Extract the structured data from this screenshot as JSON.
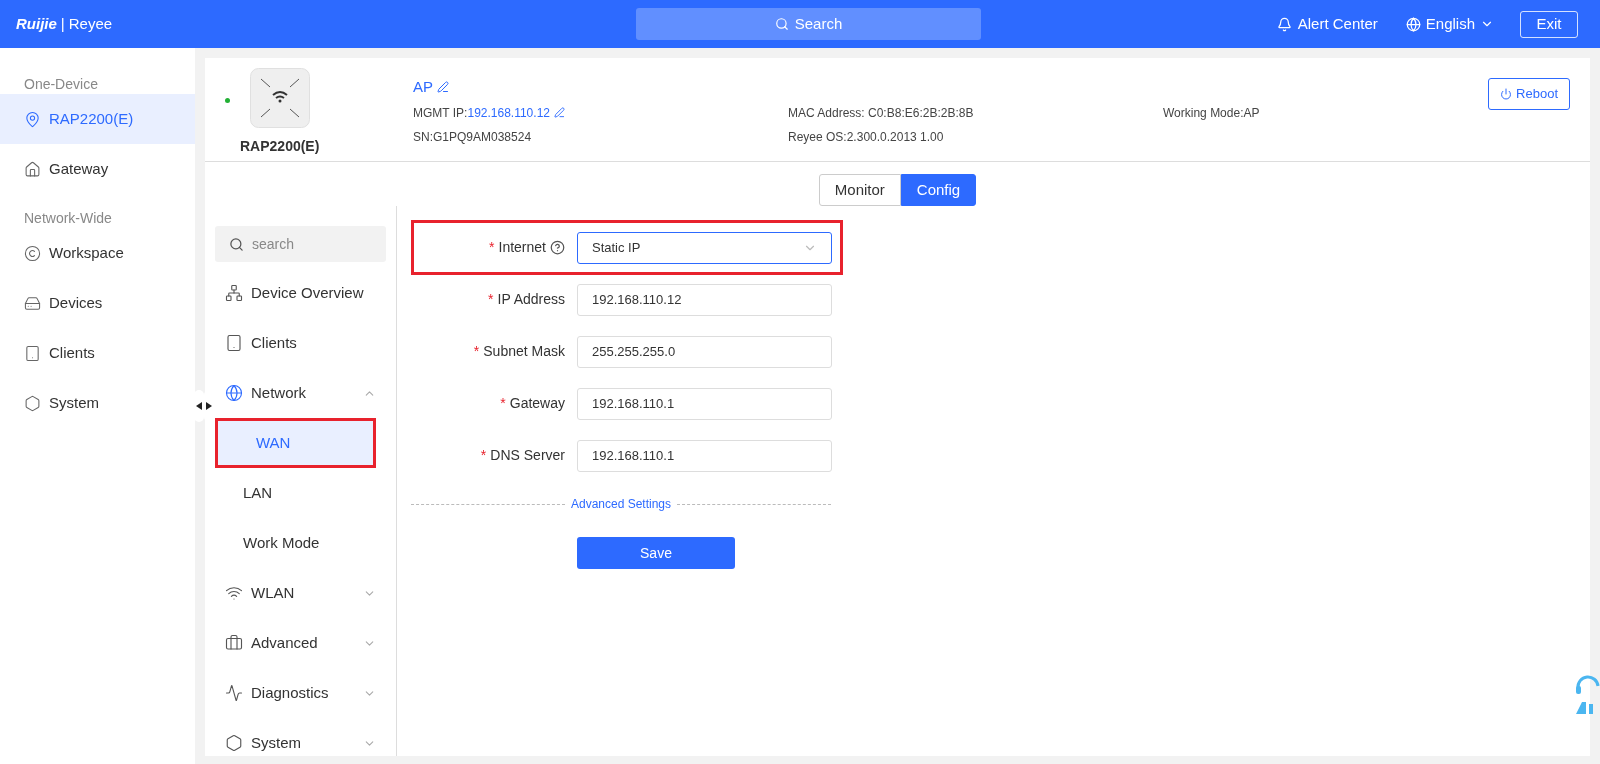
{
  "header": {
    "logo": {
      "brand": "Ruijie",
      "separator": "|",
      "product": "Reyee"
    },
    "search": "Search",
    "alert": "Alert Center",
    "language": "English",
    "exit": "Exit"
  },
  "sidebar": {
    "sections": [
      {
        "title": "One-Device",
        "items": [
          {
            "label": "RAP2200(E)",
            "selected": true
          },
          {
            "label": "Gateway",
            "selected": false
          }
        ]
      },
      {
        "title": "Network-Wide",
        "items": [
          {
            "label": "Workspace",
            "selected": false
          },
          {
            "label": "Devices",
            "selected": false
          },
          {
            "label": "Clients",
            "selected": false
          },
          {
            "label": "System",
            "selected": false
          }
        ]
      }
    ]
  },
  "device": {
    "online": true,
    "model": "RAP2200(E)",
    "name": "AP",
    "mgmt_ip_label": "MGMT IP:",
    "mgmt_ip": "192.168.110.12",
    "sn": "SN:G1PQ9AM038524",
    "mac": "MAC Address: C0:B8:E6:2B:2B:8B",
    "os": "Reyee OS:2.300.0.2013 1.00",
    "mode": "Working Mode:AP",
    "reboot": "Reboot"
  },
  "tabs": [
    {
      "label": "Monitor",
      "selected": false
    },
    {
      "label": "Config",
      "selected": true
    }
  ],
  "menu": {
    "search_placeholder": "search",
    "items": [
      {
        "label": "Device Overview"
      },
      {
        "label": "Clients"
      },
      {
        "label": "Network",
        "expanded": true,
        "children": [
          {
            "label": "WAN",
            "selected": true,
            "highlighted": true
          },
          {
            "label": "LAN",
            "selected": false,
            "highlighted": false
          },
          {
            "label": "Work Mode",
            "selected": false,
            "highlighted": false
          }
        ]
      },
      {
        "label": "WLAN",
        "expanded": false
      },
      {
        "label": "Advanced",
        "expanded": false
      },
      {
        "label": "Diagnostics",
        "expanded": false
      },
      {
        "label": "System",
        "expanded": false
      }
    ]
  },
  "form": {
    "fields": [
      {
        "kind": "select",
        "required_mark": "*",
        "label": "Internet",
        "help": true,
        "value": "Static IP",
        "highlighted": true
      },
      {
        "kind": "input",
        "required_mark": "*",
        "label": "IP Address",
        "help": false,
        "value": "192.168.110.12",
        "highlighted": false
      },
      {
        "kind": "input",
        "required_mark": "*",
        "label": "Subnet Mask",
        "help": false,
        "value": "255.255.255.0",
        "highlighted": false
      },
      {
        "kind": "input",
        "required_mark": "*",
        "label": "Gateway",
        "help": false,
        "value": "192.168.110.1",
        "highlighted": false
      },
      {
        "kind": "input",
        "required_mark": "*",
        "label": "DNS Server",
        "help": false,
        "value": "192.168.110.1",
        "highlighted": false
      }
    ],
    "advanced": "Advanced Settings",
    "save": "Save"
  }
}
